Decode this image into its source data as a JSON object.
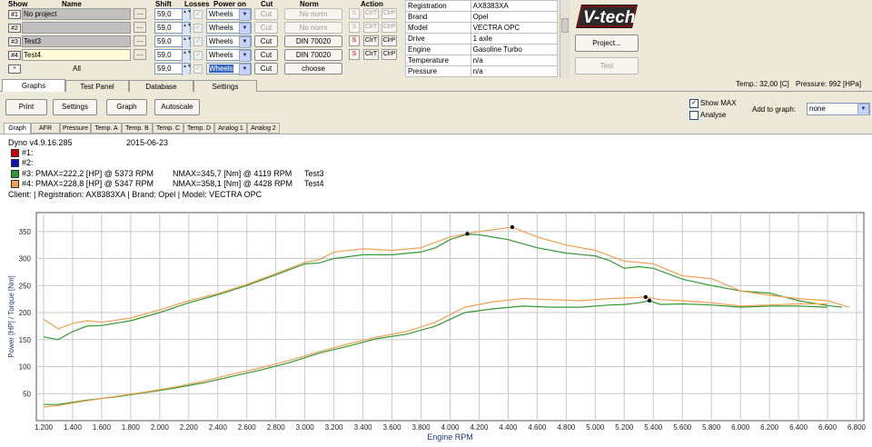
{
  "header": {
    "show": "Show",
    "name": "Name",
    "shift": "Shift",
    "losses": "Losses",
    "power_on": "Power on",
    "cut": "Cut",
    "norm": "Norm",
    "action": "Action"
  },
  "rows": [
    {
      "id": "#1",
      "name": "No project",
      "shift": "59,0",
      "power": "Wheels",
      "cut": "Cut",
      "norm": "No norm"
    },
    {
      "id": "#2",
      "name": "",
      "shift": "59,0",
      "power": "Wheels",
      "cut": "Cut",
      "norm": "No norm"
    },
    {
      "id": "#3",
      "name": "Test3",
      "shift": "59,0",
      "power": "Wheels",
      "cut": "Cut",
      "norm": "DIN 70020"
    },
    {
      "id": "#4",
      "name": "Test4",
      "shift": "59,0",
      "power": "Wheels",
      "cut": "Cut",
      "norm": "DIN 70020"
    },
    {
      "id": "*",
      "name": "All",
      "shift": "59,0",
      "power": "Wheels",
      "cut": "Cut",
      "norm": "choose"
    }
  ],
  "actions": {
    "s": "S",
    "clrt": "ClrT",
    "clrp": "ClrP"
  },
  "dots_label": "...",
  "spin_glyph": "▲▼",
  "combo_arrow": "▼",
  "check_mark": "✓",
  "info": [
    {
      "k": "Registration",
      "v": "AX8383XA"
    },
    {
      "k": "Brand",
      "v": "Opel"
    },
    {
      "k": "Model",
      "v": "VECTRA OPC"
    },
    {
      "k": "Drive",
      "v": "1 axle"
    },
    {
      "k": "Engine",
      "v": "Gasoline Turbo"
    },
    {
      "k": "Temperature",
      "v": "n/a"
    },
    {
      "k": "Pressure",
      "v": "n/a"
    }
  ],
  "logo": "V-tech",
  "project_button": "Project...",
  "test_button": "Test",
  "status": {
    "temp": "Temp.: 32,00 [C]",
    "pressure": "Pressure: 992 [HPa]"
  },
  "main_tabs": [
    "Graphs",
    "Test Panel",
    "Database",
    "Settings"
  ],
  "toolbar": {
    "print": "Print",
    "settings": "Settings",
    "graph": "Graph",
    "autoscale": "Autoscale"
  },
  "show_max": "Show MAX",
  "analyse": "Analyse",
  "add_to_graph": "Add to graph:",
  "add_to_graph_value": "none",
  "sub_tabs": [
    "Graph",
    "AFR",
    "Pressure",
    "Temp. A",
    "Temp. B",
    "Temp. C",
    "Temp. D",
    "Analog 1",
    "Analog 2"
  ],
  "info_text": {
    "version": "Dyno v4.9.16.285",
    "date": "2015-06-23",
    "l1": "#1:",
    "l2": "#2:",
    "l3a": "#3: PMAX=222,2 [HP] @ 5373 RPM",
    "l3b": "NMAX=345,7 [Nm] @ 4119 RPM",
    "l3c": "Test3",
    "l4a": "#4: PMAX=228,8 [HP] @ 5347 RPM",
    "l4b": "NMAX=358,1 [Nm] @ 4428 RPM",
    "l4c": "Test4",
    "client": "Client:  | Registration: AX8383XA | Brand: Opel | Model: VECTRA OPC"
  },
  "colors": {
    "c1": "#cc0000",
    "c2": "#1010c0",
    "c3": "#339933",
    "c4": "#f0a050"
  },
  "chart_data": {
    "type": "line",
    "xlabel": "Engine RPM",
    "ylabel": "Power [HP] / Torque [Nm]",
    "xlim": [
      1150,
      6850
    ],
    "ylim": [
      0,
      385
    ],
    "xticks": [
      "1.200",
      "1.400",
      "1.600",
      "1.800",
      "2.000",
      "2.200",
      "2.400",
      "2.600",
      "2.800",
      "3.000",
      "3.200",
      "3.400",
      "3.600",
      "3.800",
      "4.000",
      "4.200",
      "4.400",
      "4.600",
      "4.800",
      "5.000",
      "5.200",
      "5.400",
      "5.600",
      "5.800",
      "6.000",
      "6.200",
      "6.400",
      "6.600",
      "6.800"
    ],
    "yticks": [
      "50",
      "100",
      "150",
      "200",
      "250",
      "300",
      "350"
    ],
    "grid": true,
    "series": [
      {
        "name": "Test3",
        "color": "#339933",
        "x": [
          1200,
          1300,
          1400,
          1500,
          1600,
          1800,
          2000,
          2200,
          2400,
          2600,
          2800,
          3000,
          3100,
          3200,
          3400,
          3600,
          3800,
          3900,
          4000,
          4119,
          4200,
          4400,
          4600,
          4800,
          5000,
          5100,
          5200,
          5300,
          5400,
          5600,
          5800,
          6000,
          6200,
          6400,
          6600,
          6700
        ],
        "y": [
          155,
          150,
          165,
          175,
          176,
          185,
          200,
          218,
          233,
          250,
          270,
          290,
          292,
          300,
          307,
          307,
          312,
          320,
          335,
          345,
          344,
          335,
          320,
          310,
          305,
          296,
          282,
          285,
          282,
          262,
          250,
          240,
          236,
          222,
          213,
          210
        ]
      },
      {
        "name": "Test4",
        "color": "#f0a050",
        "x": [
          1200,
          1300,
          1400,
          1500,
          1600,
          1800,
          2000,
          2200,
          2400,
          2600,
          2800,
          3000,
          3100,
          3200,
          3400,
          3600,
          3800,
          4000,
          4200,
          4428,
          4600,
          4800,
          5000,
          5200,
          5300,
          5400,
          5600,
          5800,
          6000,
          6200,
          6400,
          6600,
          6750
        ],
        "y": [
          188,
          170,
          180,
          185,
          182,
          190,
          205,
          222,
          235,
          252,
          272,
          293,
          298,
          312,
          318,
          315,
          320,
          340,
          350,
          358,
          340,
          325,
          315,
          295,
          293,
          290,
          268,
          263,
          240,
          232,
          226,
          222,
          210
        ]
      },
      {
        "name": "Test3 power",
        "color": "#339933",
        "x": [
          1200,
          1300,
          1500,
          1700,
          1900,
          2100,
          2300,
          2500,
          2700,
          2900,
          3100,
          3300,
          3500,
          3700,
          3900,
          4100,
          4300,
          4500,
          4700,
          4900,
          5100,
          5200,
          5300,
          5373,
          5450,
          5600,
          5800,
          6000,
          6200,
          6400,
          6600
        ],
        "y": [
          30,
          30,
          38,
          44,
          52,
          60,
          70,
          82,
          94,
          108,
          125,
          138,
          152,
          160,
          175,
          200,
          207,
          212,
          210,
          210,
          214,
          215,
          218,
          222,
          215,
          216,
          214,
          210,
          212,
          212,
          210
        ]
      },
      {
        "name": "Test4 power",
        "color": "#f0a050",
        "x": [
          1200,
          1300,
          1500,
          1700,
          1900,
          2100,
          2300,
          2500,
          2700,
          2900,
          3100,
          3300,
          3500,
          3700,
          3900,
          4100,
          4300,
          4500,
          4700,
          4900,
          5100,
          5200,
          5300,
          5347,
          5450,
          5600,
          5800,
          6000,
          6200,
          6400,
          6600
        ],
        "y": [
          25,
          28,
          37,
          45,
          53,
          62,
          73,
          86,
          98,
          112,
          128,
          142,
          155,
          165,
          182,
          210,
          220,
          226,
          224,
          222,
          226,
          227,
          228,
          229,
          224,
          222,
          218,
          212,
          214,
          216,
          216
        ]
      }
    ],
    "markers": [
      {
        "x": 4119,
        "y": 345.7
      },
      {
        "x": 4428,
        "y": 358.1
      },
      {
        "x": 5373,
        "y": 222.2
      },
      {
        "x": 5347,
        "y": 228.8
      }
    ]
  }
}
